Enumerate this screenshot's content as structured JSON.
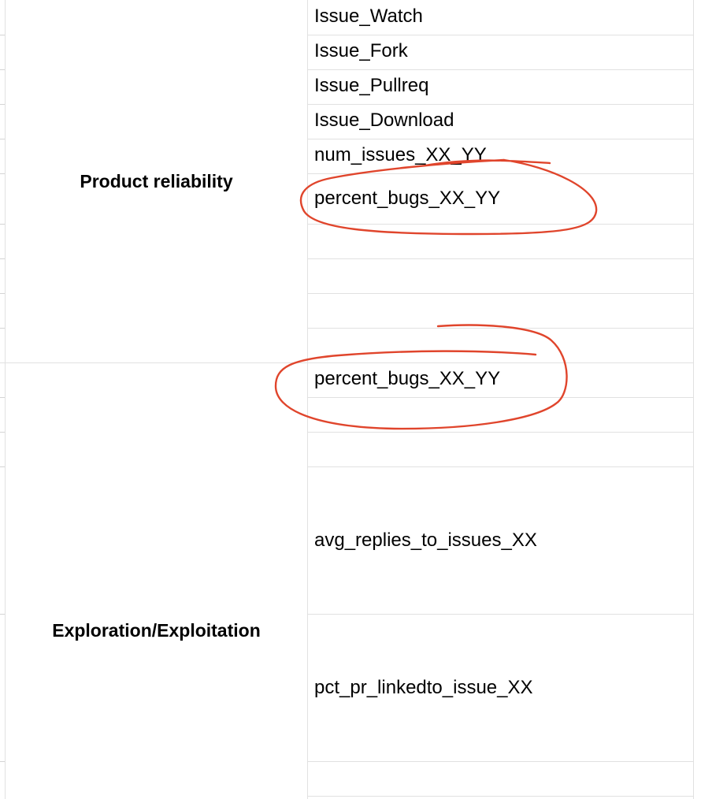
{
  "groups": [
    {
      "label": "Product reliability",
      "metrics": [
        "Issue_Watch",
        "Issue_Fork",
        "Issue_Pullreq",
        "Issue_Download",
        "num_issues_XX_YY",
        "percent_bugs_XX_YY"
      ]
    },
    {
      "label": "Exploration/Exploitation",
      "metrics": [
        "percent_bugs_XX_YY",
        "avg_replies_to_issues_XX",
        "pct_pr_linkedto_issue_XX"
      ]
    }
  ],
  "annotation_color": "#e0452c",
  "grid_color": "#e1e1e1"
}
